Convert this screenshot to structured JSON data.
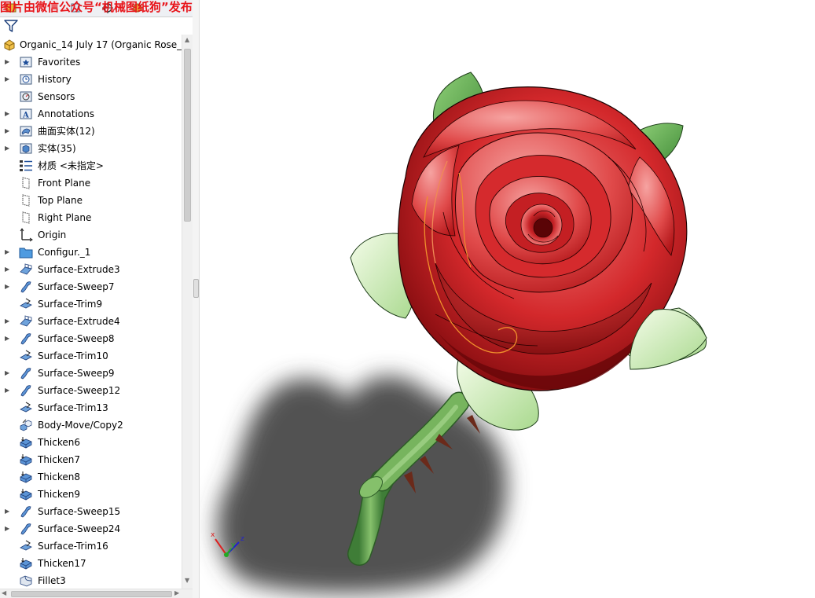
{
  "watermark": "图片由微信公众号“机械图纸狗”发布",
  "tree": {
    "root_label": "Organic_14 July 17  (Organic Rose_",
    "items": [
      {
        "label": "Favorites",
        "icon": "favorites-folder-icon",
        "expandable": true
      },
      {
        "label": "History",
        "icon": "history-folder-icon",
        "expandable": true
      },
      {
        "label": "Sensors",
        "icon": "sensors-icon",
        "expandable": false
      },
      {
        "label": "Annotations",
        "icon": "annotations-folder-icon",
        "expandable": true
      },
      {
        "label": "曲面实体(12)",
        "icon": "surface-bodies-folder-icon",
        "expandable": true
      },
      {
        "label": "实体(35)",
        "icon": "solid-bodies-folder-icon",
        "expandable": true
      },
      {
        "label": "材质 <未指定>",
        "icon": "material-icon",
        "expandable": false
      },
      {
        "label": "Front Plane",
        "icon": "plane-icon",
        "expandable": false
      },
      {
        "label": "Top Plane",
        "icon": "plane-icon",
        "expandable": false
      },
      {
        "label": "Right Plane",
        "icon": "plane-icon",
        "expandable": false
      },
      {
        "label": "Origin",
        "icon": "origin-icon",
        "expandable": false
      },
      {
        "label": "Configur._1",
        "icon": "folder-icon",
        "expandable": true
      },
      {
        "label": "Surface-Extrude3",
        "icon": "surface-extrude-icon",
        "expandable": true
      },
      {
        "label": "Surface-Sweep7",
        "icon": "surface-sweep-icon",
        "expandable": true
      },
      {
        "label": "Surface-Trim9",
        "icon": "surface-trim-icon",
        "expandable": false
      },
      {
        "label": "Surface-Extrude4",
        "icon": "surface-extrude-icon",
        "expandable": true
      },
      {
        "label": "Surface-Sweep8",
        "icon": "surface-sweep-icon",
        "expandable": true
      },
      {
        "label": "Surface-Trim10",
        "icon": "surface-trim-icon",
        "expandable": false
      },
      {
        "label": "Surface-Sweep9",
        "icon": "surface-sweep-icon",
        "expandable": true
      },
      {
        "label": "Surface-Sweep12",
        "icon": "surface-sweep-icon",
        "expandable": true
      },
      {
        "label": "Surface-Trim13",
        "icon": "surface-trim-icon",
        "expandable": false
      },
      {
        "label": "Body-Move/Copy2",
        "icon": "body-move-copy-icon",
        "expandable": false
      },
      {
        "label": "Thicken6",
        "icon": "thicken-icon",
        "expandable": false
      },
      {
        "label": "Thicken7",
        "icon": "thicken-icon",
        "expandable": false
      },
      {
        "label": "Thicken8",
        "icon": "thicken-icon",
        "expandable": false
      },
      {
        "label": "Thicken9",
        "icon": "thicken-icon",
        "expandable": false
      },
      {
        "label": "Surface-Sweep15",
        "icon": "surface-sweep-icon",
        "expandable": true
      },
      {
        "label": "Surface-Sweep24",
        "icon": "surface-sweep-icon",
        "expandable": true
      },
      {
        "label": "Surface-Trim16",
        "icon": "surface-trim-icon",
        "expandable": false
      },
      {
        "label": "Thicken17",
        "icon": "thicken-icon",
        "expandable": false
      },
      {
        "label": "Fillet3",
        "icon": "fillet-icon",
        "expandable": false
      }
    ]
  },
  "colors": {
    "watermark": "#e8151b",
    "petal_dark": "#8e0d10",
    "petal_mid": "#d42a2c",
    "petal_light": "#f27171",
    "leaf_dark": "#5e9c4a",
    "leaf_light": "#d9f4c2",
    "stem": "#6aa356",
    "shadow": "#4a4a4a"
  },
  "triad": {
    "x": "x",
    "y": "y",
    "z": "z"
  }
}
